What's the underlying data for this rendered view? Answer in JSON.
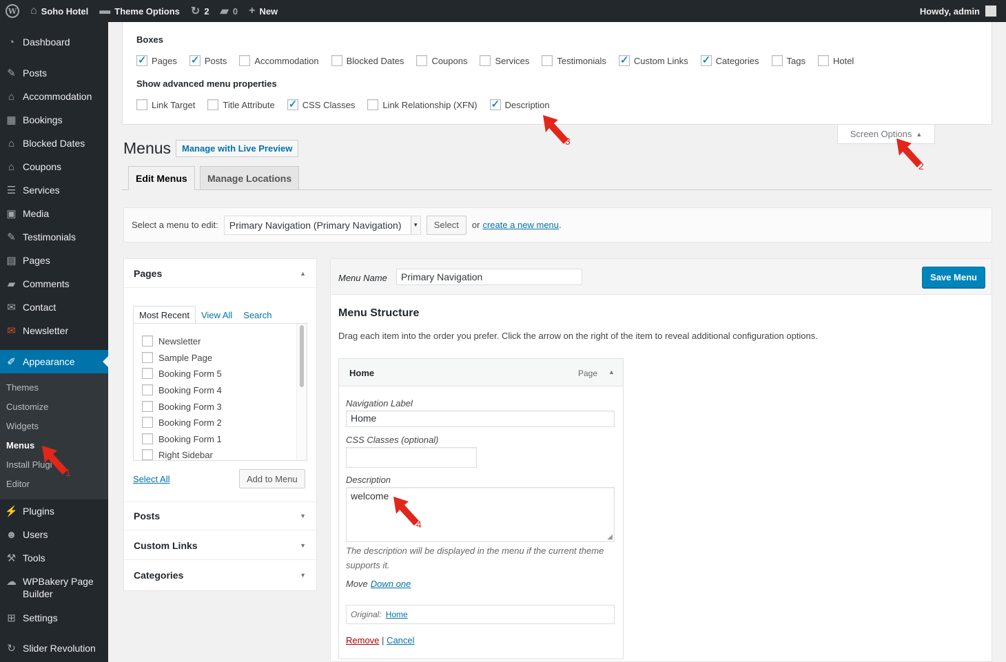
{
  "adminbar": {
    "site_name": "Soho Hotel",
    "theme_options": "Theme Options",
    "updates_count": "2",
    "comments_count": "0",
    "new_label": "New",
    "howdy": "Howdy, admin"
  },
  "sidebar": {
    "items": [
      {
        "label": "Dashboard",
        "icon": "dashboard-icon"
      },
      {
        "label": "Posts",
        "icon": "pin-icon"
      },
      {
        "label": "Accommodation",
        "icon": "home-icon"
      },
      {
        "label": "Bookings",
        "icon": "calendar-icon"
      },
      {
        "label": "Blocked Dates",
        "icon": "home-icon"
      },
      {
        "label": "Coupons",
        "icon": "home-icon"
      },
      {
        "label": "Services",
        "icon": "list-icon"
      },
      {
        "label": "Media",
        "icon": "media-icon"
      },
      {
        "label": "Testimonials",
        "icon": "pin-icon"
      },
      {
        "label": "Pages",
        "icon": "page-icon"
      },
      {
        "label": "Comments",
        "icon": "comment-icon"
      },
      {
        "label": "Contact",
        "icon": "mail-icon"
      },
      {
        "label": "Newsletter",
        "icon": "mail-icon"
      },
      {
        "label": "Appearance",
        "icon": "brush-icon"
      },
      {
        "label": "Plugins",
        "icon": "plug-icon"
      },
      {
        "label": "Users",
        "icon": "user-icon"
      },
      {
        "label": "Tools",
        "icon": "wrench-icon"
      },
      {
        "label": "WPBakery Page Builder",
        "icon": "cloud-icon"
      },
      {
        "label": "Settings",
        "icon": "settings-icon"
      },
      {
        "label": "Slider Revolution",
        "icon": "refresh-icon"
      }
    ],
    "submenu": [
      "Themes",
      "Customize",
      "Widgets",
      "Menus",
      "Install Plugi",
      "Editor"
    ]
  },
  "screen_options": {
    "boxes_heading": "Boxes",
    "boxes": [
      {
        "label": "Pages",
        "checked": true
      },
      {
        "label": "Posts",
        "checked": true
      },
      {
        "label": "Accommodation",
        "checked": false
      },
      {
        "label": "Blocked Dates",
        "checked": false
      },
      {
        "label": "Coupons",
        "checked": false
      },
      {
        "label": "Services",
        "checked": false
      },
      {
        "label": "Testimonials",
        "checked": false
      },
      {
        "label": "Custom Links",
        "checked": true
      },
      {
        "label": "Categories",
        "checked": true
      },
      {
        "label": "Tags",
        "checked": false
      },
      {
        "label": "Hotel",
        "checked": false
      }
    ],
    "advanced_heading": "Show advanced menu properties",
    "advanced": [
      {
        "label": "Link Target",
        "checked": false
      },
      {
        "label": "Title Attribute",
        "checked": false
      },
      {
        "label": "CSS Classes",
        "checked": true
      },
      {
        "label": "Link Relationship (XFN)",
        "checked": false
      },
      {
        "label": "Description",
        "checked": true
      }
    ],
    "tab_label": "Screen Options"
  },
  "page": {
    "title": "Menus",
    "live_preview": "Manage with Live Preview",
    "tabs": [
      "Edit Menus",
      "Manage Locations"
    ]
  },
  "manage": {
    "select_label": "Select a menu to edit:",
    "selected_menu": "Primary Navigation (Primary Navigation)",
    "select_button": "Select",
    "or_text": "or",
    "create_link": "create a new menu",
    "period": "."
  },
  "accordion": {
    "sections": [
      "Pages",
      "Posts",
      "Custom Links",
      "Categories"
    ],
    "inner_tabs": [
      "Most Recent",
      "View All",
      "Search"
    ],
    "pages": [
      "Newsletter",
      "Sample Page",
      "Booking Form 5",
      "Booking Form 4",
      "Booking Form 3",
      "Booking Form 2",
      "Booking Form 1",
      "Right Sidebar"
    ],
    "select_all": "Select All",
    "add_to_menu": "Add to Menu"
  },
  "menu": {
    "name_label": "Menu Name",
    "name_value": "Primary Navigation",
    "save_label": "Save Menu",
    "structure_title": "Menu Structure",
    "structure_desc": "Drag each item into the order you prefer. Click the arrow on the right of the item to reveal additional configuration options.",
    "item": {
      "title": "Home",
      "type": "Page",
      "nav_label_label": "Navigation Label",
      "nav_label_value": "Home",
      "css_label": "CSS Classes (optional)",
      "css_value": "",
      "desc_label": "Description",
      "desc_value": "welcome",
      "help_text": "The description will be displayed in the menu if the current theme supports it.",
      "move_label": "Move",
      "move_link": "Down one",
      "original_label": "Original:",
      "original_link": "Home",
      "remove": "Remove",
      "separator": "|",
      "cancel": "Cancel"
    }
  },
  "annotations": [
    "1",
    "2",
    "3",
    "4"
  ],
  "colors": {
    "accent": "#0073aa",
    "arrow": "#e2261a",
    "admin_dark": "#23282d"
  }
}
